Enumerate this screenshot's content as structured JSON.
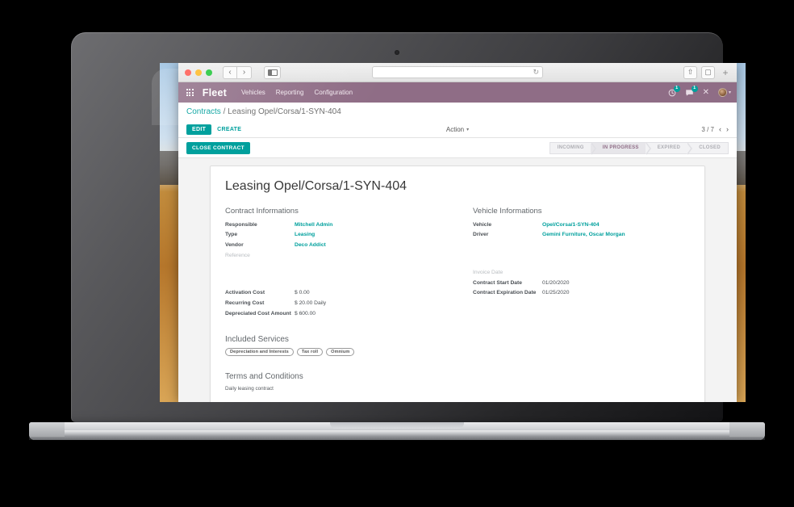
{
  "browser": {
    "traffic_lights": [
      "close",
      "minimize",
      "maximize"
    ],
    "back_label": "‹",
    "forward_label": "›",
    "url_value": "",
    "reload_label": "↻",
    "share_label": "⇧",
    "tabs_label": "▢",
    "new_tab_label": "+"
  },
  "navbar": {
    "brand": "Fleet",
    "menus": [
      "Vehicles",
      "Reporting",
      "Configuration"
    ],
    "activity_badge": "1",
    "messages_badge": "1",
    "close_label": "✕",
    "user_caret": "▾",
    "bg_color": "#8f6d86"
  },
  "control_panel": {
    "breadcrumb_root": "Contracts",
    "breadcrumb_separator": "/",
    "breadcrumb_current": "Leasing Opel/Corsa/1-SYN-404",
    "edit_label": "EDIT",
    "create_label": "CREATE",
    "action_label": "Action",
    "action_caret": "▾",
    "pager_text": "3 / 7",
    "pager_prev": "‹",
    "pager_next": "›"
  },
  "statusbar": {
    "button_label": "CLOSE CONTRACT",
    "stages": [
      "INCOMING",
      "IN PROGRESS",
      "EXPIRED",
      "CLOSED"
    ],
    "active_stage": "IN PROGRESS",
    "active_color": "#8f6d86",
    "accent_color": "#00a09d"
  },
  "record": {
    "title": "Leasing Opel/Corsa/1-SYN-404",
    "contract_group_title": "Contract Informations",
    "vehicle_group_title": "Vehicle Informations",
    "contract_fields": [
      {
        "label": "Responsible",
        "value": "Mitchell Admin",
        "link": true
      },
      {
        "label": "Type",
        "value": "Leasing",
        "link": true
      },
      {
        "label": "Vendor",
        "value": "Deco Addict",
        "link": true
      },
      {
        "label": "Reference",
        "value": "",
        "link": false,
        "muted": true
      }
    ],
    "cost_fields": [
      {
        "label": "Activation Cost",
        "value": "$ 0.00"
      },
      {
        "label": "Recurring Cost",
        "value": "$ 20.00  Daily"
      },
      {
        "label": "Depreciated Cost Amount",
        "value": "$ 600.00"
      }
    ],
    "vehicle_fields": [
      {
        "label": "Vehicle",
        "value": "Opel/Corsa/1-SYN-404",
        "link": true
      },
      {
        "label": "Driver",
        "value": "Gemini Furniture, Oscar Morgan",
        "link": true
      }
    ],
    "date_fields": [
      {
        "label": "Invoice Date",
        "value": "",
        "muted": true
      },
      {
        "label": "Contract Start Date",
        "value": "01/20/2020"
      },
      {
        "label": "Contract Expiration Date",
        "value": "01/25/2020"
      }
    ],
    "services_title": "Included Services",
    "services_tags": [
      "Depreciation and Interests",
      "Tax roll",
      "Omnium"
    ],
    "terms_title": "Terms and Conditions",
    "terms_body": "Daily leasing contract"
  }
}
